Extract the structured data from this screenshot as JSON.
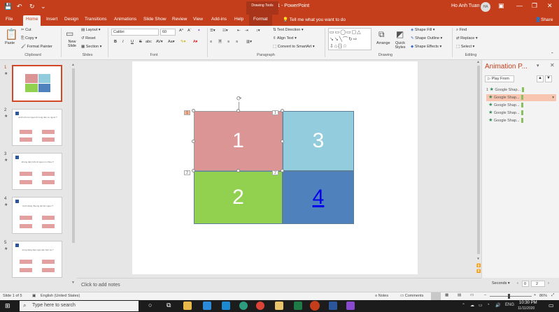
{
  "window": {
    "title": "Presentation1 - PowerPoint",
    "context_group": "Drawing Tools",
    "user": "Ho Anh Tuan",
    "avatar_initials": "HA"
  },
  "tabs": [
    "File",
    "Home",
    "Insert",
    "Design",
    "Transitions",
    "Animations",
    "Slide Show",
    "Review",
    "View",
    "Add-ins",
    "Help",
    "Format"
  ],
  "active_tab": "Home",
  "tell_me": "Tell me what you want to do",
  "share": "Share",
  "ribbon": {
    "clipboard": {
      "paste": "Paste",
      "cut": "Cut",
      "copy": "Copy",
      "format_painter": "Format Painter",
      "label": "Clipboard"
    },
    "slides": {
      "new_slide": "New Slide",
      "layout": "Layout",
      "reset": "Reset",
      "section": "Section",
      "label": "Slides"
    },
    "font": {
      "name": "Calibri",
      "size": "60",
      "label": "Font",
      "bold": "B",
      "italic": "I",
      "underline": "U",
      "strike": "S",
      "shadow": "abc"
    },
    "paragraph": {
      "text_direction": "Text Direction",
      "align_text": "Align Text",
      "smartart": "Convert to SmartArt",
      "label": "Paragraph"
    },
    "drawing": {
      "arrange": "Arrange",
      "quick_styles": "Quick Styles",
      "shape_fill": "Shape Fill",
      "shape_outline": "Shape Outline",
      "shape_effects": "Shape Effects",
      "label": "Drawing"
    },
    "editing": {
      "find": "Find",
      "replace": "Replace",
      "select": "Select",
      "label": "Editing"
    }
  },
  "thumbnails": [
    {
      "num": "1",
      "selected": true
    },
    {
      "num": "2",
      "text": "at khi di mot nguoi di cung dan ve  nguoi ?"
    },
    {
      "num": "3",
      "text": "khong dat it khi di nguoi co nhieu ?"
    },
    {
      "num": "4",
      "text": "ra thi dang thuong da het nguoi ?"
    },
    {
      "num": "5",
      "text": "trong dang bao ngoi den ban xa ?"
    }
  ],
  "slide": {
    "cells": [
      {
        "label": "1",
        "color": "#dc9595"
      },
      {
        "label": "3",
        "color": "#93cddd"
      },
      {
        "label": "2",
        "color": "#92d050"
      },
      {
        "label": "4",
        "color": "#4f81bd"
      }
    ],
    "tags": [
      "1",
      "1",
      "2",
      "2"
    ]
  },
  "animation_pane": {
    "title": "Animation P...",
    "play": "Play From",
    "items": [
      {
        "num": "1",
        "label": "Google Shap...",
        "selected": false
      },
      {
        "num": "",
        "label": "Google Shap...",
        "selected": true
      },
      {
        "num": "",
        "label": "Google Shap...",
        "selected": false
      },
      {
        "num": "",
        "label": "Google Shap...",
        "selected": false
      },
      {
        "num": "",
        "label": "Google Shap...",
        "selected": false
      }
    ],
    "seconds": "Seconds",
    "zoom_from": "0",
    "zoom_to": "2"
  },
  "notes": "Click to add notes",
  "status": {
    "slide": "Slide 1 of 5",
    "language": "English (United States)",
    "notes": "Notes",
    "comments": "Comments",
    "zoom": "86%"
  },
  "taskbar": {
    "search": "Type here to search",
    "time": "10:30 PM",
    "date": "11/11/2020",
    "lang": "ENG"
  }
}
